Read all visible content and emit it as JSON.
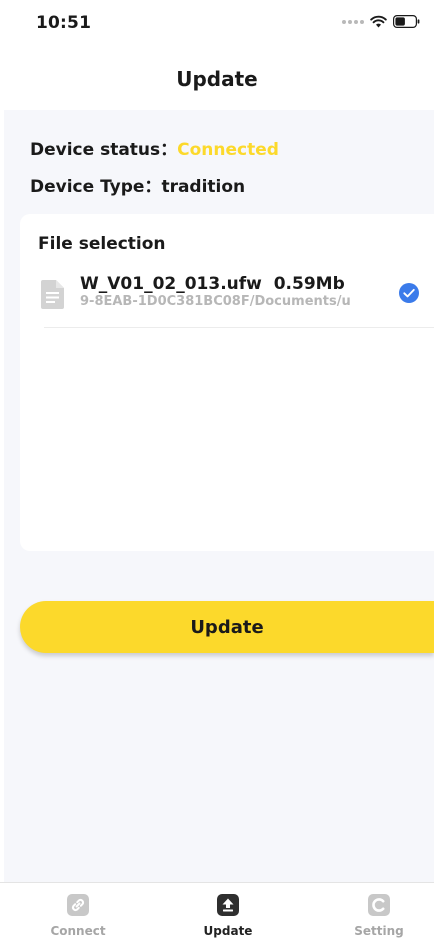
{
  "status_bar": {
    "time": "10:51"
  },
  "nav": {
    "title": "Update"
  },
  "device": {
    "status_label": "Device status：",
    "status_value": "Connected",
    "type_label": "Device Type：",
    "type_value": "tradition"
  },
  "file_selection": {
    "title": "File selection",
    "files": [
      {
        "name": "W_V01_02_013.ufw",
        "size": "0.59Mb",
        "path": "9-8EAB-1D0C381BC08F/Documents/u",
        "selected": true
      }
    ]
  },
  "update_button": {
    "label": "Update"
  },
  "tabs": [
    {
      "label": "Connect",
      "icon": "link-icon",
      "active": false
    },
    {
      "label": "Update",
      "icon": "upload-icon",
      "active": true
    },
    {
      "label": "Setting",
      "icon": "settings-icon",
      "active": false
    }
  ],
  "colors": {
    "accent": "#fcd92b",
    "check": "#3b7bea",
    "background": "#f6f7fb"
  }
}
